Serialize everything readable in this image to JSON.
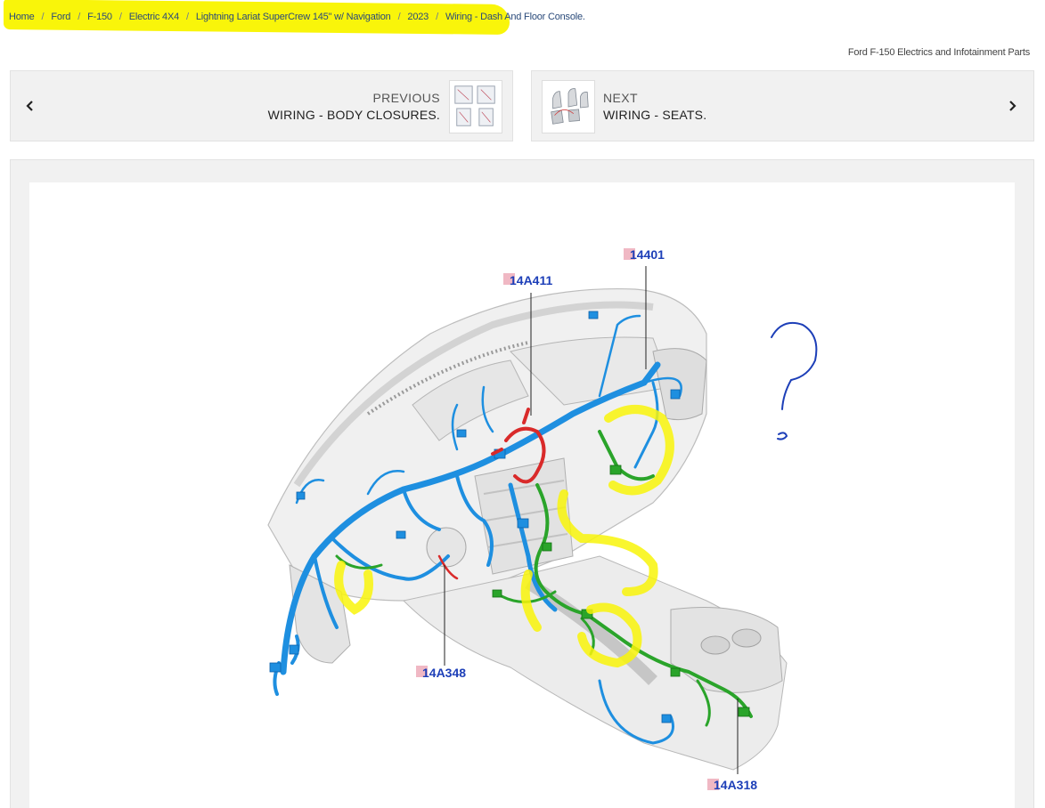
{
  "breadcrumb": {
    "items": [
      "Home",
      "Ford",
      "F-150",
      "Electric 4X4",
      "Lightning Lariat SuperCrew 145\" w/ Navigation",
      "2023",
      "Wiring - Dash And Floor Console."
    ],
    "separator": "/"
  },
  "category_link": "Ford F-150 Electrics and Infotainment Parts",
  "nav": {
    "previous": {
      "kicker": "PREVIOUS",
      "title": "WIRING - BODY CLOSURES."
    },
    "next": {
      "kicker": "NEXT",
      "title": "WIRING - SEATS."
    }
  },
  "diagram": {
    "callouts": [
      "14401",
      "14A411",
      "14A348",
      "14A318"
    ],
    "annotation_mark": "?"
  },
  "colors": {
    "highlight": "#f9f50a",
    "callout_text": "#1d3fb8",
    "callout_marker": "#f0b8c4",
    "harness_blue": "#1e8fe0",
    "harness_green": "#2aa42a",
    "harness_red": "#d92a2a"
  }
}
